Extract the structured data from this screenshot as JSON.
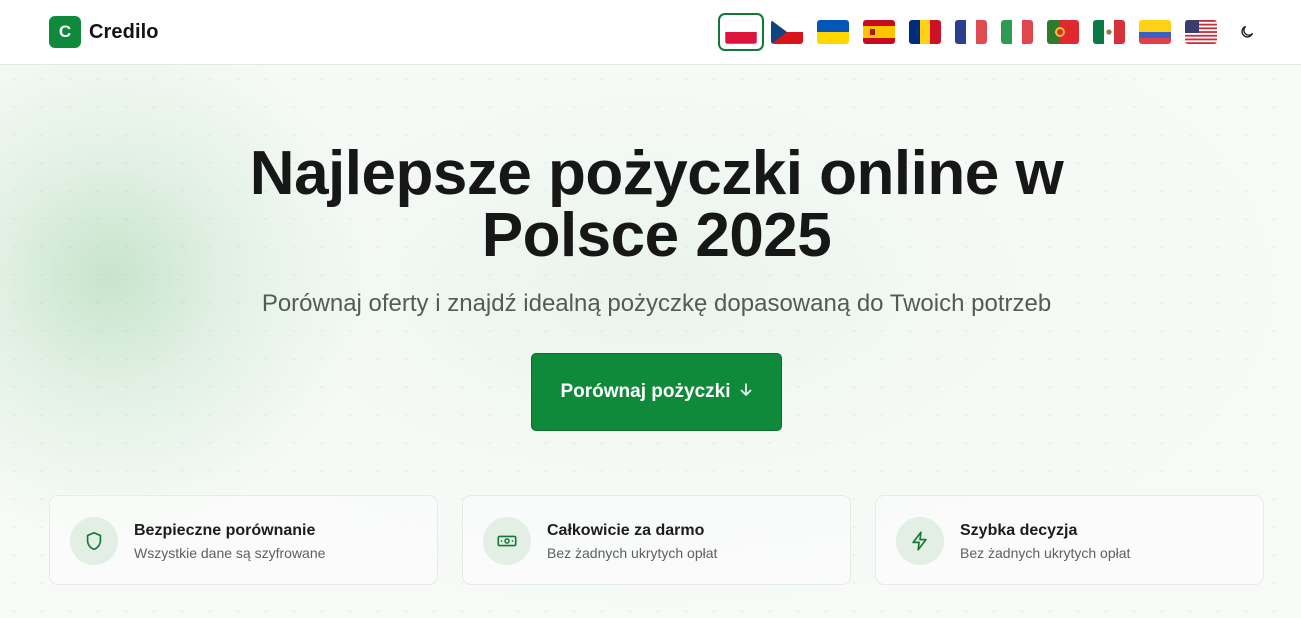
{
  "brand": {
    "logo_letter": "C",
    "name": "Credilo",
    "accent": "#0f8a3a"
  },
  "header": {
    "flags": [
      {
        "name": "flag-poland",
        "active": true
      },
      {
        "name": "flag-czech-republic",
        "active": false
      },
      {
        "name": "flag-ukraine",
        "active": false
      },
      {
        "name": "flag-spain",
        "active": false
      },
      {
        "name": "flag-romania",
        "active": false
      },
      {
        "name": "flag-france",
        "active": false
      },
      {
        "name": "flag-italy",
        "active": false
      },
      {
        "name": "flag-portugal",
        "active": false
      },
      {
        "name": "flag-mexico",
        "active": false
      },
      {
        "name": "flag-colombia",
        "active": false
      },
      {
        "name": "flag-usa",
        "active": false
      }
    ],
    "theme_icon": "moon-icon"
  },
  "hero": {
    "title_line1": "Najlepsze pożyczki online w",
    "title_line2": "Polsce 2025",
    "subtitle": "Porównaj oferty i znajdź idealną pożyczkę dopasowaną do Twoich potrzeb",
    "cta_label": "Porównaj pożyczki",
    "cta_icon": "arrow-down-icon"
  },
  "features": [
    {
      "icon": "shield-icon",
      "title": "Bezpieczne porównanie",
      "desc": "Wszystkie dane są szyfrowane"
    },
    {
      "icon": "banknote-icon",
      "title": "Całkowicie za darmo",
      "desc": "Bez żadnych ukrytych opłat"
    },
    {
      "icon": "lightning-icon",
      "title": "Szybka decyzja",
      "desc": "Bez żadnych ukrytych opłat"
    }
  ]
}
